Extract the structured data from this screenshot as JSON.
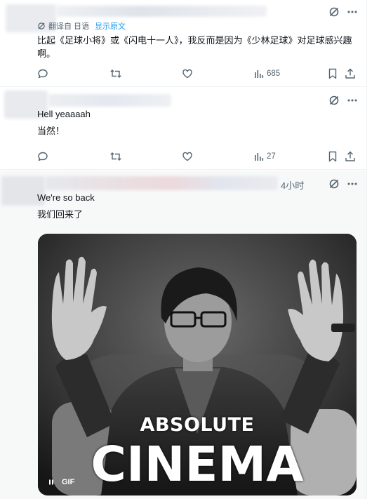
{
  "tweets": [
    {
      "translation_label": "翻译自 日语",
      "show_original_label": "显示原文",
      "text": "比起《足球小将》或《闪电十一人》，我反而是因为《少林足球》对足球感兴趣啊。",
      "views": "685"
    },
    {
      "original_text": "Hell yeaaaah",
      "translated_text": "当然！",
      "views": "27"
    },
    {
      "time": "4小时",
      "original_text": "We're so back",
      "translated_text": "我们回来了",
      "media": {
        "caption_line1": "ABSOLUTE",
        "caption_line2": "CINEMA",
        "gif_badge": "GIF"
      }
    }
  ],
  "colors": {
    "text": "#0f1419",
    "secondary": "#536471",
    "accent": "#1d9bf0",
    "divider": "#eff3f4"
  },
  "icons": [
    "grok-slash-icon",
    "more-icon",
    "translate-icon",
    "reply-icon",
    "retweet-icon",
    "like-icon",
    "views-icon",
    "bookmark-icon",
    "share-icon",
    "pause-icon"
  ]
}
